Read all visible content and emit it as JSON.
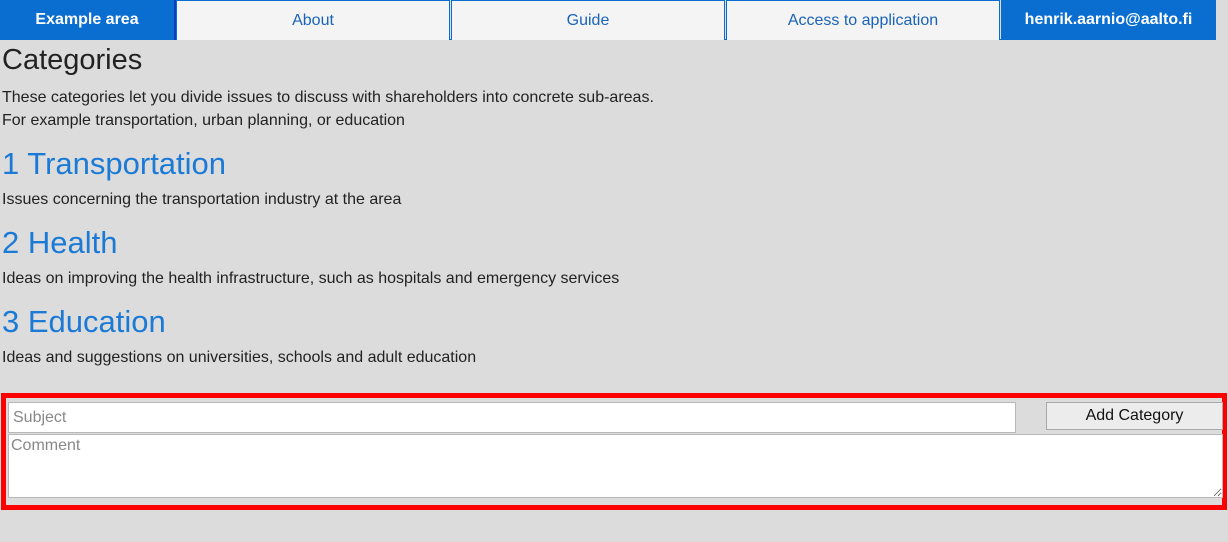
{
  "nav": {
    "brand": "Example area",
    "links": [
      "About",
      "Guide",
      "Access to application"
    ],
    "user": "henrik.aarnio@aalto.fi"
  },
  "page": {
    "title": "Categories",
    "intro_line1": "These categories let you divide issues to discuss with shareholders into concrete sub-areas.",
    "intro_line2": "For example transportation, urban planning, or education"
  },
  "categories": [
    {
      "heading": "1 Transportation",
      "description": "Issues concerning the transportation industry at the area"
    },
    {
      "heading": "2 Health",
      "description": "Ideas on improving the health infrastructure, such as hospitals and emergency services"
    },
    {
      "heading": "3 Education",
      "description": "Ideas and suggestions on universities, schools and adult education"
    }
  ],
  "form": {
    "subject_placeholder": "Subject",
    "comment_placeholder": "Comment",
    "add_label": "Add Category"
  },
  "colors": {
    "nav_blue": "#0a6ed1",
    "link_blue": "#1a7ad6",
    "highlight_red": "#ff0000",
    "background": "#dcdcdc"
  }
}
